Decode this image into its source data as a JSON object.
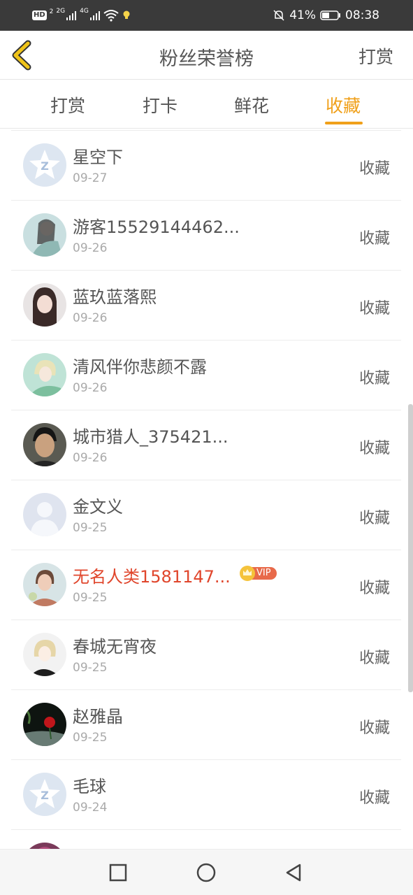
{
  "status_bar": {
    "hd_label": "HD",
    "sim_label": "2",
    "net_2g": "2G",
    "net_4g": "4G",
    "battery_percent": "41%",
    "time": "08:38"
  },
  "header": {
    "title": "粉丝荣誉榜",
    "right_action": "打赏"
  },
  "tabs": [
    {
      "label": "打赏",
      "active": false
    },
    {
      "label": "打卡",
      "active": false
    },
    {
      "label": "鲜花",
      "active": false
    },
    {
      "label": "收藏",
      "active": true
    }
  ],
  "colors": {
    "accent": "#f0a01a",
    "vip_name": "#e0462c",
    "vip_badge": "#e86a4a"
  },
  "fans": [
    {
      "name": "星空下",
      "date": "09-27",
      "action": "收藏",
      "avatar": "default-q-avatar",
      "vip": false
    },
    {
      "name": "游客15529144462...",
      "date": "09-26",
      "action": "收藏",
      "avatar": "photo-avatar",
      "vip": false
    },
    {
      "name": "蓝玖蓝落熙",
      "date": "09-26",
      "action": "收藏",
      "avatar": "photo-avatar",
      "vip": false
    },
    {
      "name": "清风伴你悲颜不露",
      "date": "09-26",
      "action": "收藏",
      "avatar": "photo-avatar",
      "vip": false
    },
    {
      "name": "城市猎人_375421...",
      "date": "09-26",
      "action": "收藏",
      "avatar": "photo-avatar",
      "vip": false
    },
    {
      "name": "金文义",
      "date": "09-25",
      "action": "收藏",
      "avatar": "default-person-avatar",
      "vip": false
    },
    {
      "name": "无名人类1581147...",
      "date": "09-25",
      "action": "收藏",
      "avatar": "photo-avatar",
      "vip": true,
      "vip_label": "VIP"
    },
    {
      "name": "春城无宵夜",
      "date": "09-25",
      "action": "收藏",
      "avatar": "photo-avatar",
      "vip": false
    },
    {
      "name": "赵雅晶",
      "date": "09-25",
      "action": "收藏",
      "avatar": "photo-avatar",
      "vip": false
    },
    {
      "name": "毛球",
      "date": "09-24",
      "action": "收藏",
      "avatar": "default-q-avatar",
      "vip": false
    }
  ]
}
